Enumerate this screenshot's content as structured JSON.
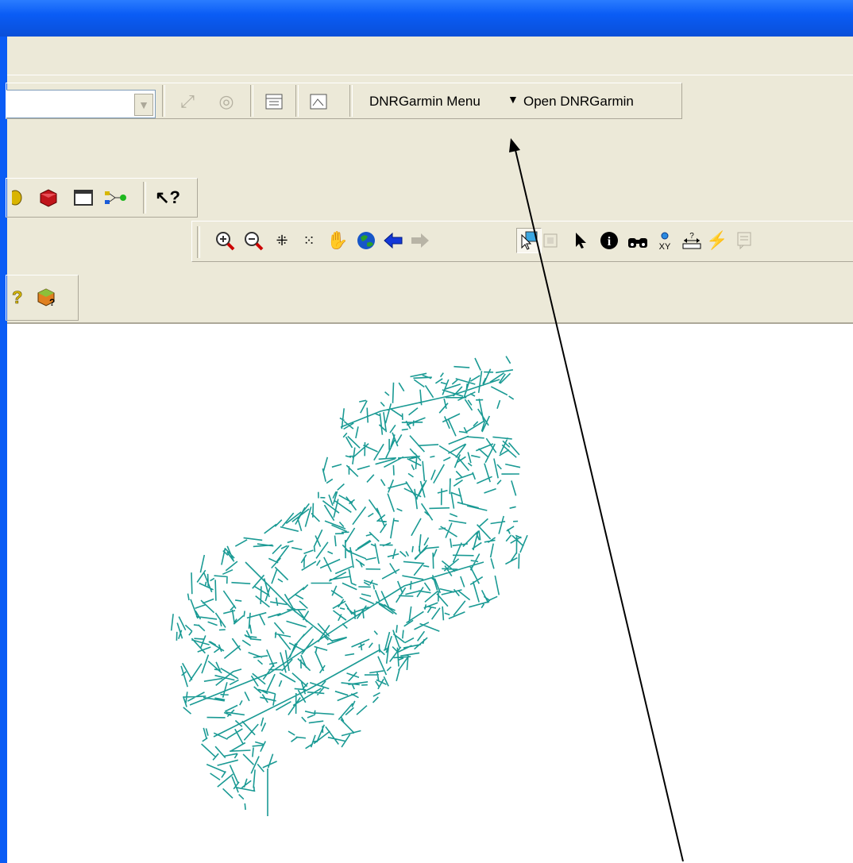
{
  "window": {
    "title": ""
  },
  "toolbar_custom": {
    "menu_label": "DNRGarmin Menu",
    "menu_arrow": "▼",
    "open_label": "Open DNRGarmin"
  },
  "toolbar_standard": {
    "icons": [
      "map-icon",
      "red-box-icon",
      "window-icon",
      "model-builder-icon",
      "whats-this-icon"
    ]
  },
  "toolbar_tools": {
    "icons": [
      "zoom-in-icon",
      "zoom-out-icon",
      "fixed-zoom-in-icon",
      "fixed-zoom-out-icon",
      "pan-icon",
      "full-extent-icon",
      "back-extent-icon",
      "forward-extent-icon",
      "select-features-icon",
      "clear-selection-icon",
      "select-elements-icon",
      "identify-icon",
      "find-icon",
      "go-to-xy-icon",
      "measure-icon",
      "hyperlink-icon",
      "html-popup-icon"
    ]
  },
  "colors": {
    "title_blue": "#0a5cf5",
    "map_line": "#1a9a94",
    "toolbar_bg": "#ece9d8"
  }
}
